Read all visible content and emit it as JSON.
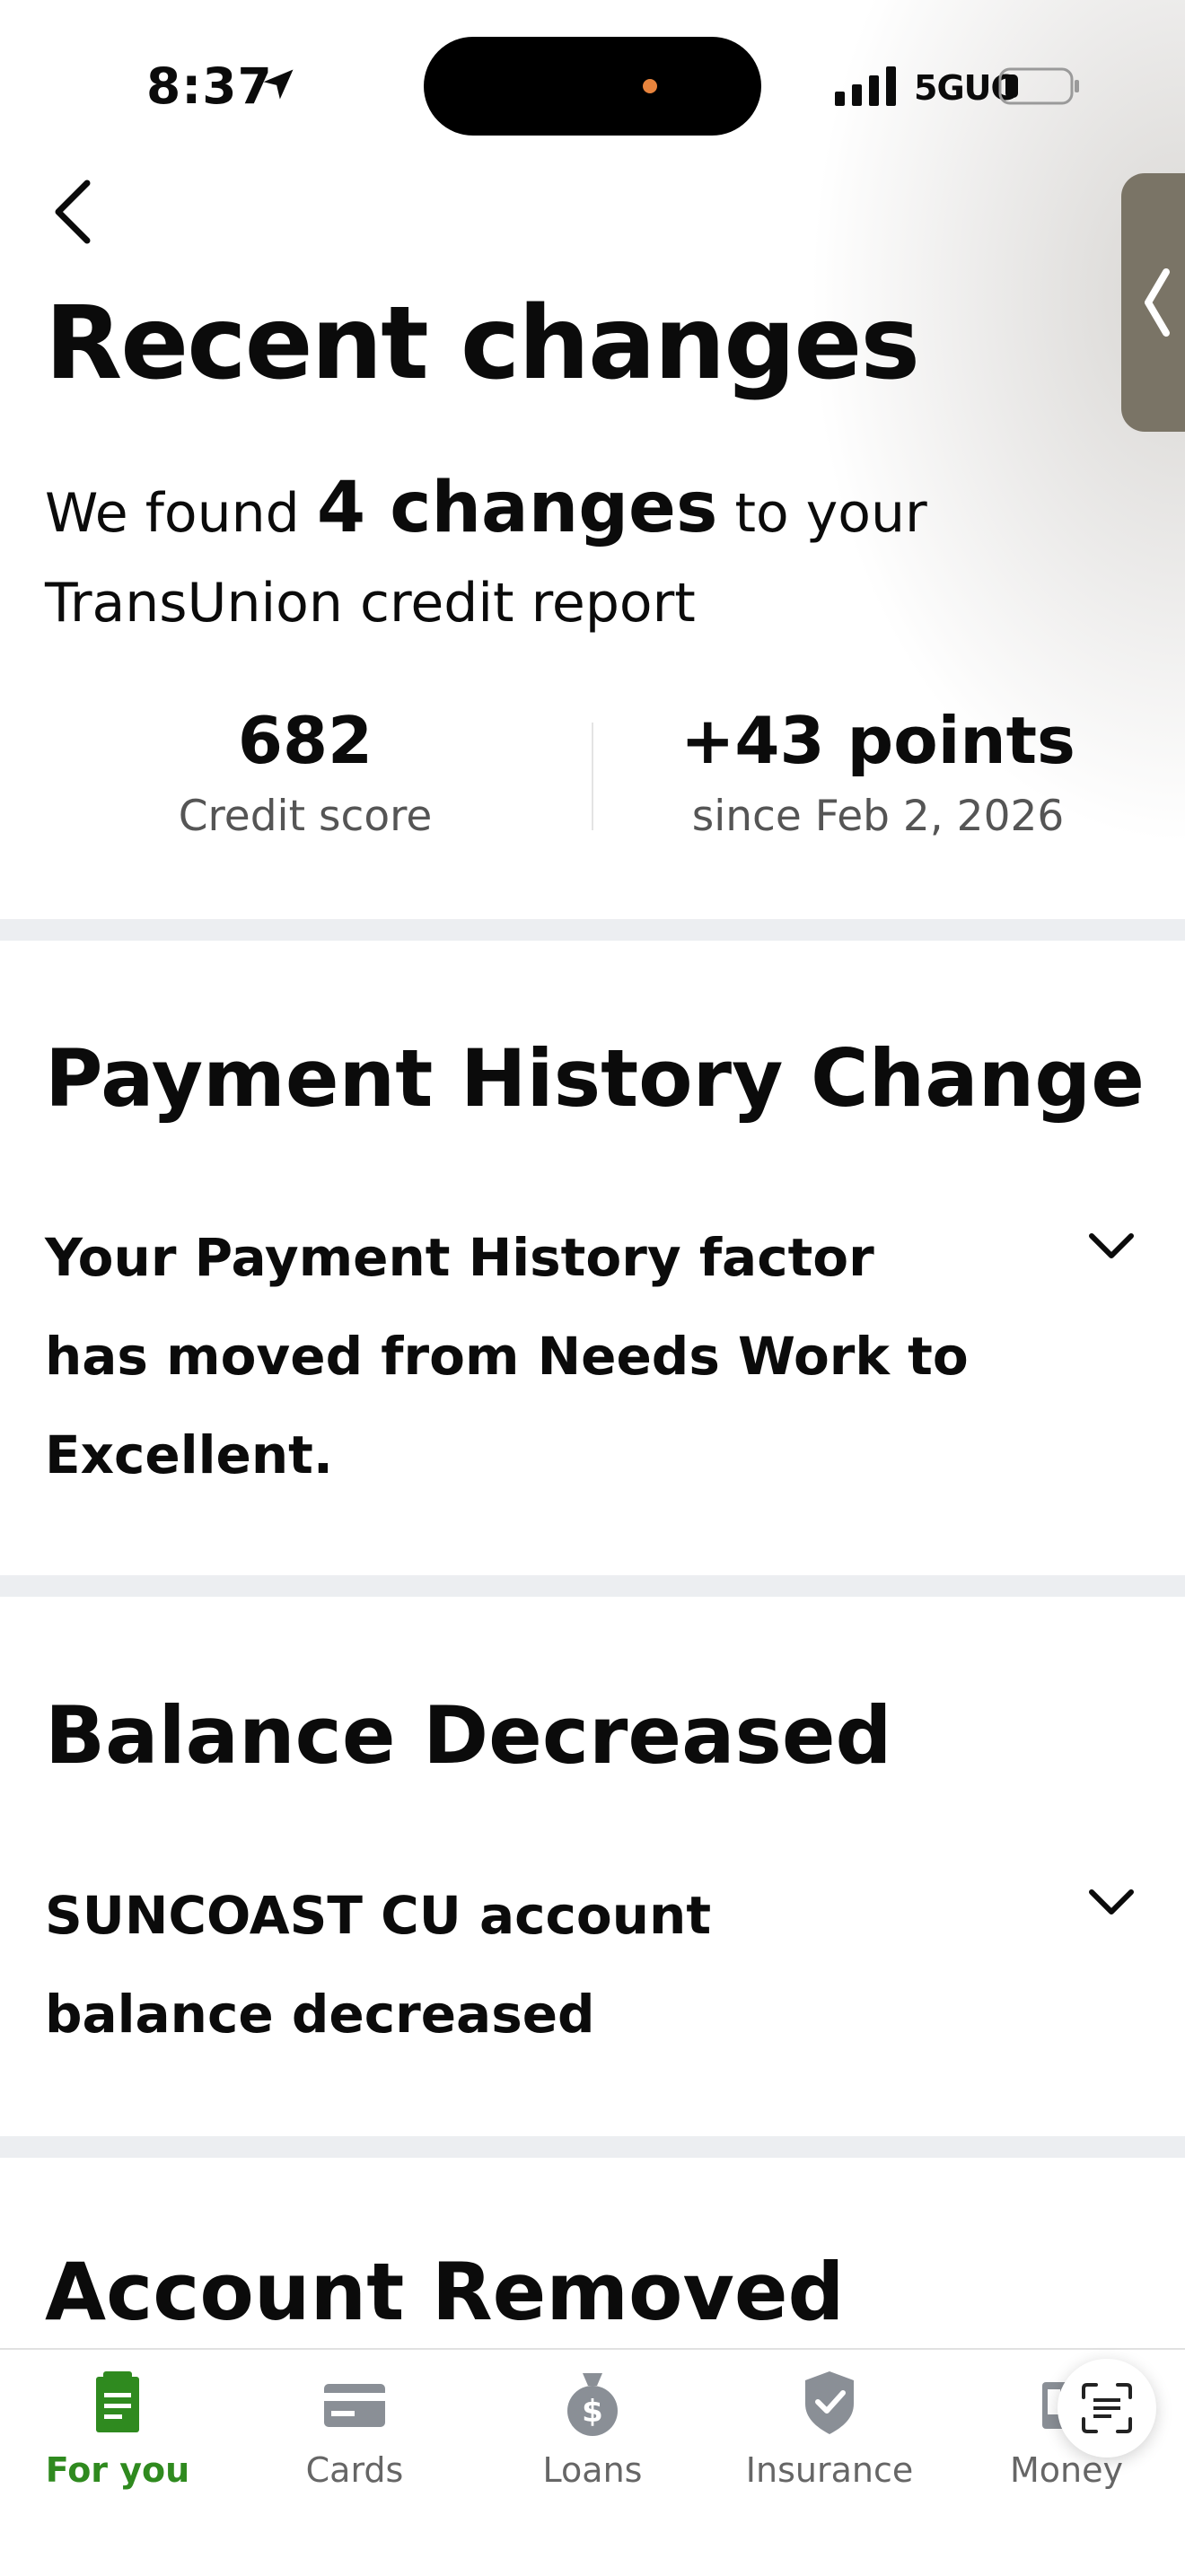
{
  "status_bar": {
    "time": "8:37",
    "network": "5GUC",
    "icons": [
      "location-arrow-icon",
      "signal-icon",
      "battery-icon"
    ]
  },
  "nav": {
    "back_icon": "chevron-left-icon",
    "side_tab_icon": "chevron-left-icon"
  },
  "header": {
    "title": "Recent changes",
    "summary_prefix": "We found",
    "summary_highlight": "4 changes",
    "summary_line1_suffix": "to your",
    "summary_line2": "TransUnion credit report"
  },
  "stats": {
    "score_value": "682",
    "score_label": "Credit score",
    "change_value": "+43 points",
    "change_label": "since Feb 2, 2026"
  },
  "sections": [
    {
      "title": "Payment History Change",
      "body": "Your Payment History factor has moved from Needs Work to Excellent."
    },
    {
      "title": "Balance Decreased",
      "body": "SUNCOAST CU account balance decreased"
    },
    {
      "title": "Account Removed",
      "body": ""
    }
  ],
  "tabs": [
    {
      "label": "For you",
      "icon": "document-icon",
      "active": true
    },
    {
      "label": "Cards",
      "icon": "credit-card-icon",
      "active": false
    },
    {
      "label": "Loans",
      "icon": "money-bag-icon",
      "active": false
    },
    {
      "label": "Insurance",
      "icon": "shield-check-icon",
      "active": false
    },
    {
      "label": "Money",
      "icon": "wallet-icon",
      "active": false
    }
  ],
  "colors": {
    "accent": "#2f8a1f",
    "side_tab": "#7a7466",
    "divider": "#eceef1",
    "island_dot": "#e8843d"
  }
}
